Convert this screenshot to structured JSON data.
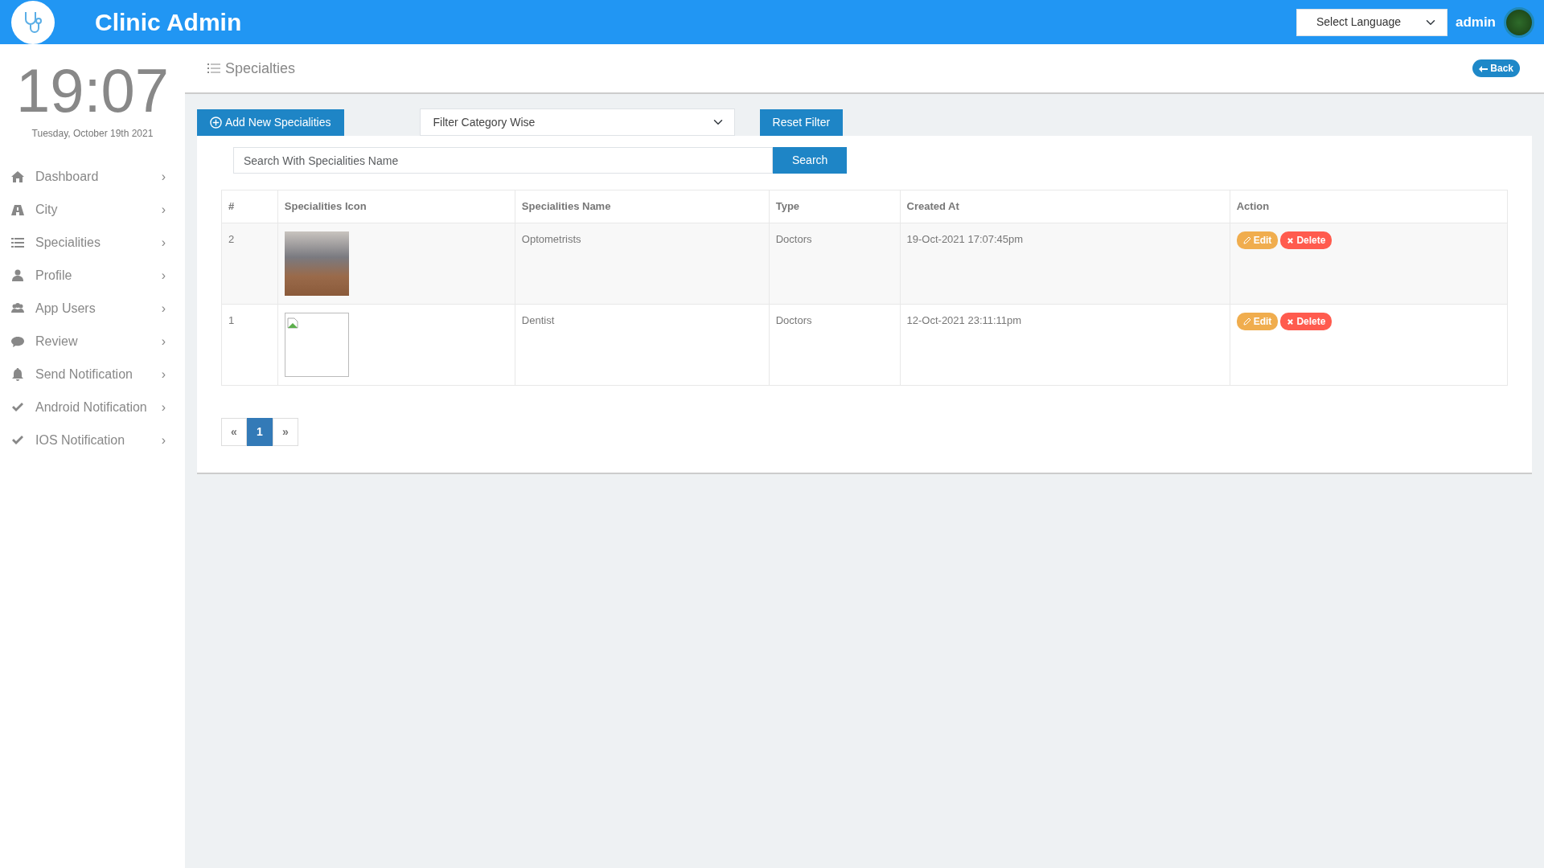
{
  "header": {
    "title": "Clinic Admin",
    "language_select": "Select Language",
    "user": "admin"
  },
  "clock": {
    "time": "19:07",
    "date": "Tuesday, October 19th 2021"
  },
  "sidebar": {
    "items": [
      {
        "label": "Dashboard",
        "kind": "home",
        "chevron": "›"
      },
      {
        "label": "City",
        "kind": "road",
        "chevron": "›"
      },
      {
        "label": "Specialities",
        "kind": "list",
        "chevron": "›"
      },
      {
        "label": "Profile",
        "kind": "user",
        "chevron": "›"
      },
      {
        "label": "App Users",
        "kind": "users",
        "chevron": "›"
      },
      {
        "label": "Review",
        "kind": "comment",
        "chevron": "›"
      },
      {
        "label": "Send Notification",
        "kind": "bell",
        "chevron": "›"
      },
      {
        "label": "Android Notification",
        "kind": "check",
        "chevron": "›"
      },
      {
        "label": "IOS Notification",
        "kind": "check",
        "chevron": "›"
      }
    ]
  },
  "page": {
    "title": "Specialties",
    "back": "Back"
  },
  "toolbar": {
    "add_button": "Add New Specialities",
    "filter_select": "Filter Category Wise",
    "reset_button": "Reset Filter"
  },
  "search": {
    "placeholder": "Search With Specialities Name",
    "button": "Search"
  },
  "table": {
    "columns": [
      "#",
      "Specialities Icon",
      "Specialities Name",
      "Type",
      "Created At",
      "Action"
    ],
    "rows": [
      {
        "number": "2",
        "kind": "photo",
        "name": "Optometrists",
        "type": "Doctors",
        "created_at": "19-Oct-2021 17:07:45pm",
        "edit": "Edit",
        "delete": "Delete"
      },
      {
        "number": "1",
        "kind": "broken",
        "name": "Dentist",
        "type": "Doctors",
        "created_at": "12-Oct-2021 23:11:11pm",
        "edit": "Edit",
        "delete": "Delete"
      }
    ]
  },
  "pagination": [
    {
      "label": "«",
      "selected": false
    },
    {
      "label": "1",
      "selected": true
    },
    {
      "label": "»",
      "selected": false
    }
  ]
}
